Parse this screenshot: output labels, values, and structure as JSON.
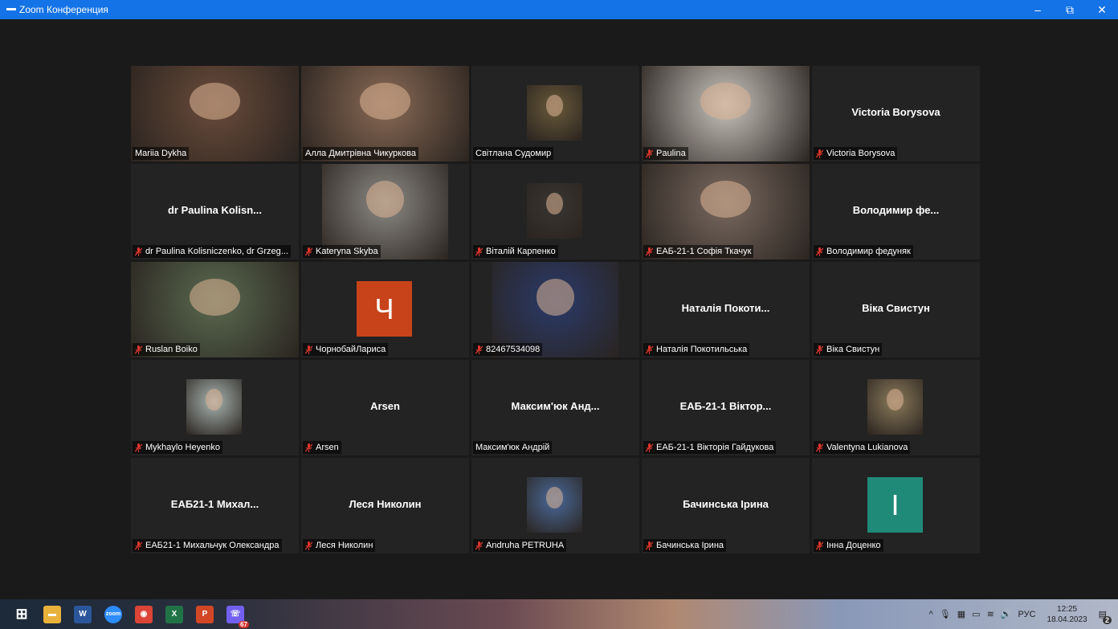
{
  "window": {
    "title": "Zoom Конференция",
    "controls": [
      "–",
      "⧉",
      "✕"
    ]
  },
  "participants": [
    {
      "label": "Mariia Dykha",
      "muted": false,
      "active": true,
      "video": "#6a4b3a"
    },
    {
      "label": "Алла Дмитрівна Чикуркова",
      "muted": false,
      "video": "#8a6a55"
    },
    {
      "label": "Світлана Судомир",
      "muted": false,
      "video": "#6a5a3a",
      "small": true
    },
    {
      "label": "Paulina",
      "muted": true,
      "video": "#c9c4bd"
    },
    {
      "label": "Victoria Borysova",
      "muted": true,
      "big_name": "Victoria Borysova"
    },
    {
      "label": "dr Paulina Kolisniczenko, dr Grzeg...",
      "muted": true,
      "big_name": "dr Paulina Kolisn..."
    },
    {
      "label": "Kateryna Skyba",
      "muted": true,
      "video": "#8d8a84",
      "medium": true
    },
    {
      "label": "Віталій Карпенко",
      "muted": true,
      "video": "#3a3632",
      "small": true
    },
    {
      "label": "ЕАБ-21-1 Софія Ткачук",
      "muted": true,
      "video": "#7a6a60"
    },
    {
      "label": "Володимир федуняк",
      "muted": true,
      "big_name": "Володимир фе..."
    },
    {
      "label": "Ruslan Boiko",
      "muted": true,
      "video": "#5a6a50"
    },
    {
      "label": "ЧорнобайЛариса",
      "muted": true,
      "avatar": "Ч",
      "avatar_color": "#c8431a"
    },
    {
      "label": "82467534098",
      "muted": true,
      "video": "#2a3a6a",
      "medium": true
    },
    {
      "label": "Наталія Покотильська",
      "muted": true,
      "big_name": "Наталія Покоти..."
    },
    {
      "label": "Віка Свистун",
      "muted": true,
      "big_name": "Віка Свистун"
    },
    {
      "label": "Mykhaylo Heyenko",
      "muted": true,
      "video": "#a8b4b0",
      "small": true
    },
    {
      "label": "Arsen",
      "muted": true,
      "big_name": "Arsen"
    },
    {
      "label": "Максим'юк Андрій",
      "muted": false,
      "big_name": "Максим'юк Анд..."
    },
    {
      "label": "ЕАБ-21-1 Вікторія Гайдукова",
      "muted": true,
      "big_name": "ЕАБ-21-1 Віктор..."
    },
    {
      "label": "Valentyna Lukianova",
      "muted": true,
      "video": "#8a7a5a",
      "small": true
    },
    {
      "label": "ЕАБ21-1 Михальчук Олександра",
      "muted": true,
      "big_name": "ЕАБ21-1 Михал..."
    },
    {
      "label": "Леся Николин",
      "muted": true,
      "big_name": "Леся Николин"
    },
    {
      "label": "Andruha PETRUHA",
      "muted": true,
      "video": "#4a6a9a",
      "small": true
    },
    {
      "label": "Бачинська Ірина",
      "muted": true,
      "big_name": "Бачинська Ірина"
    },
    {
      "label": "Інна Доценко",
      "muted": true,
      "avatar": "І",
      "avatar_color": "#1f8a78"
    }
  ],
  "taskbar": {
    "apps": [
      {
        "name": "windows-start-icon",
        "glyph": "⊞",
        "color": "transparent"
      },
      {
        "name": "file-explorer-icon",
        "glyph": "▬",
        "color": "#e8b23a"
      },
      {
        "name": "word-icon",
        "glyph": "W",
        "color": "#2b579a"
      },
      {
        "name": "zoom-icon",
        "glyph": "zoom",
        "color": "#2d8cff"
      },
      {
        "name": "chrome-icon",
        "glyph": "◉",
        "color": "#db4437"
      },
      {
        "name": "excel-icon",
        "glyph": "X",
        "color": "#217346"
      },
      {
        "name": "powerpoint-icon",
        "glyph": "P",
        "color": "#d24726"
      },
      {
        "name": "viber-icon",
        "glyph": "☏",
        "color": "#7360f2"
      }
    ],
    "viber_badge": "67",
    "tray_lang": "РУС",
    "time": "12:25",
    "date": "18.04.2023",
    "notifications": "2"
  }
}
